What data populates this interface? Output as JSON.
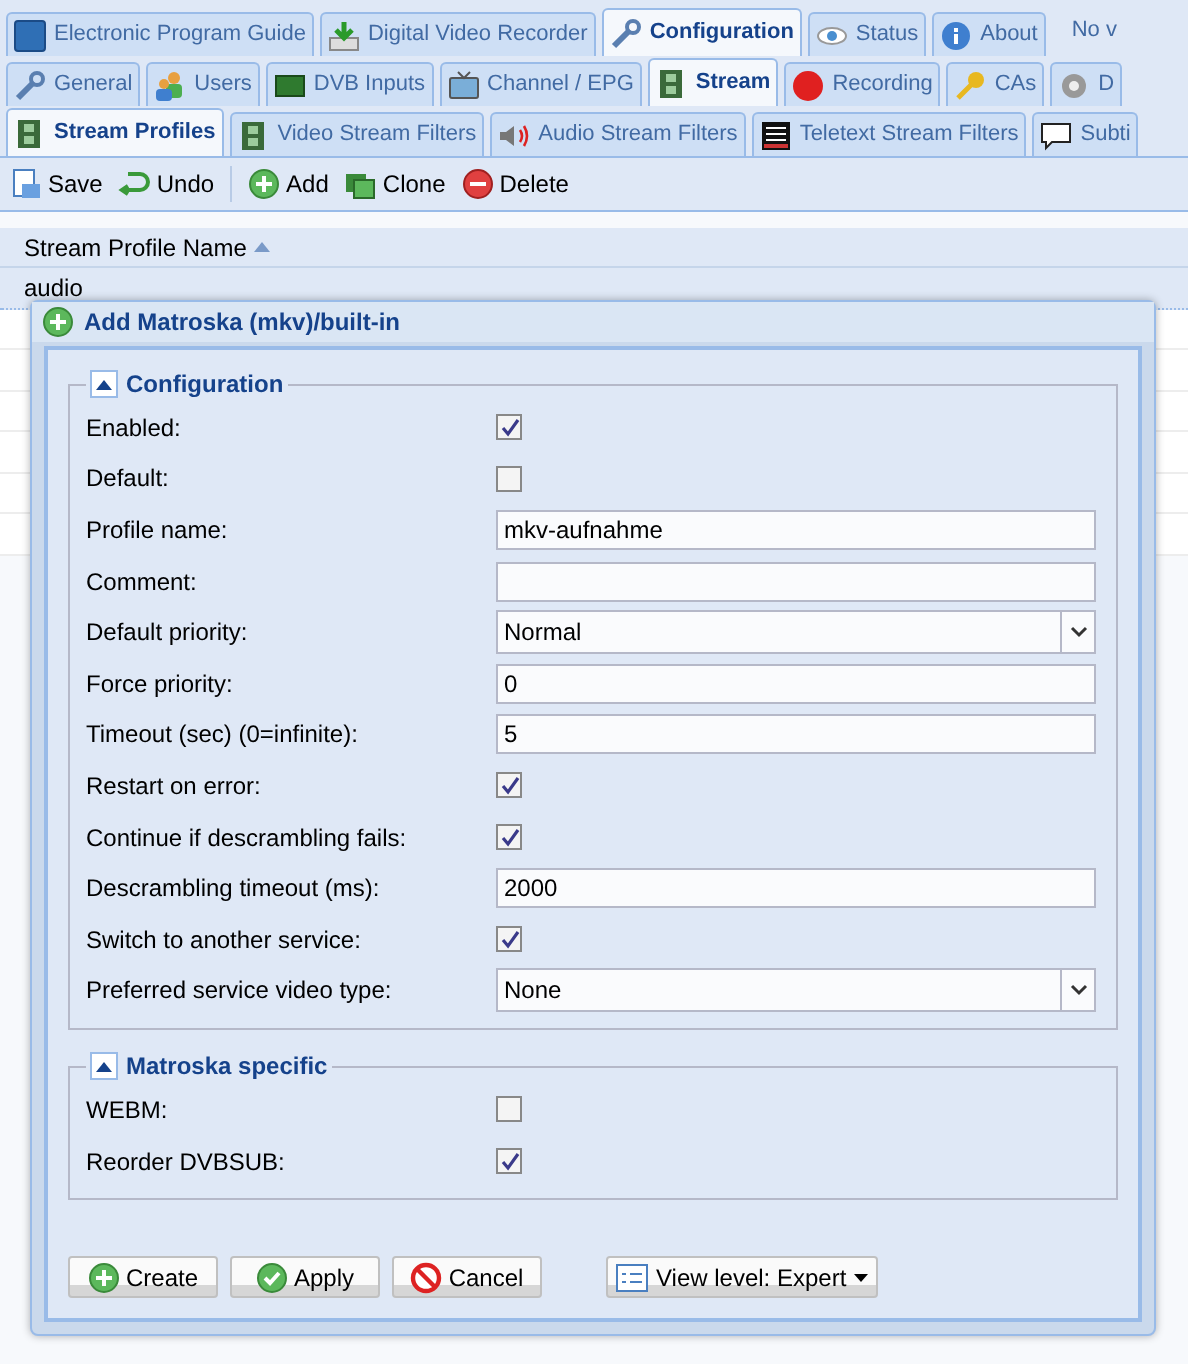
{
  "main_tabs": [
    {
      "label": "Electronic Program Guide",
      "selected": false
    },
    {
      "label": "Digital Video Recorder",
      "selected": false
    },
    {
      "label": "Configuration",
      "selected": true
    },
    {
      "label": "Status",
      "selected": false
    },
    {
      "label": "About",
      "selected": false
    }
  ],
  "status_text": "No v",
  "config_tabs": [
    {
      "label": "General",
      "selected": false
    },
    {
      "label": "Users",
      "selected": false
    },
    {
      "label": "DVB Inputs",
      "selected": false
    },
    {
      "label": "Channel / EPG",
      "selected": false
    },
    {
      "label": "Stream",
      "selected": true
    },
    {
      "label": "Recording",
      "selected": false
    },
    {
      "label": "CAs",
      "selected": false
    },
    {
      "label": "D",
      "selected": false
    }
  ],
  "stream_tabs": [
    {
      "label": "Stream Profiles",
      "selected": true
    },
    {
      "label": "Video Stream Filters",
      "selected": false
    },
    {
      "label": "Audio Stream Filters",
      "selected": false
    },
    {
      "label": "Teletext Stream Filters",
      "selected": false
    },
    {
      "label": "Subti",
      "selected": false
    }
  ],
  "toolbar": [
    "Save",
    "Undo",
    "Add",
    "Clone",
    "Delete"
  ],
  "grid": {
    "column": "Stream Profile Name",
    "rows": [
      "audio"
    ]
  },
  "dialog": {
    "title": "Add Matroska (mkv)/built-in",
    "sections": [
      {
        "title": "Configuration",
        "expanded": true,
        "fields": [
          {
            "label": "Enabled:",
            "kind": "checkbox",
            "checked": true
          },
          {
            "label": "Default:",
            "kind": "checkbox",
            "checked": false
          },
          {
            "label": "Profile name:",
            "kind": "text",
            "value": "mkv-aufnahme"
          },
          {
            "label": "Comment:",
            "kind": "text"
          },
          {
            "label": "Default priority:",
            "kind": "select",
            "value": "Normal"
          },
          {
            "label": "Force priority:",
            "kind": "text",
            "value": "0"
          },
          {
            "label": "Timeout (sec) (0=infinite):",
            "kind": "text",
            "value": "5"
          },
          {
            "label": "Restart on error:",
            "kind": "checkbox",
            "checked": true
          },
          {
            "label": "Continue if descrambling fails:",
            "kind": "checkbox",
            "checked": true
          },
          {
            "label": "Descrambling timeout (ms):",
            "kind": "text",
            "value": "2000"
          },
          {
            "label": "Switch to another service:",
            "kind": "checkbox",
            "checked": true
          },
          {
            "label": "Preferred service video type:",
            "kind": "select",
            "value": "None"
          }
        ]
      },
      {
        "title": "Matroska specific",
        "expanded": true,
        "fields": [
          {
            "label": "WEBM:",
            "kind": "checkbox",
            "checked": false
          },
          {
            "label": "Reorder DVBSUB:",
            "kind": "checkbox",
            "checked": true
          }
        ]
      }
    ],
    "buttons": [
      "Create",
      "Apply",
      "Cancel"
    ],
    "view_level": "View level: Expert"
  }
}
